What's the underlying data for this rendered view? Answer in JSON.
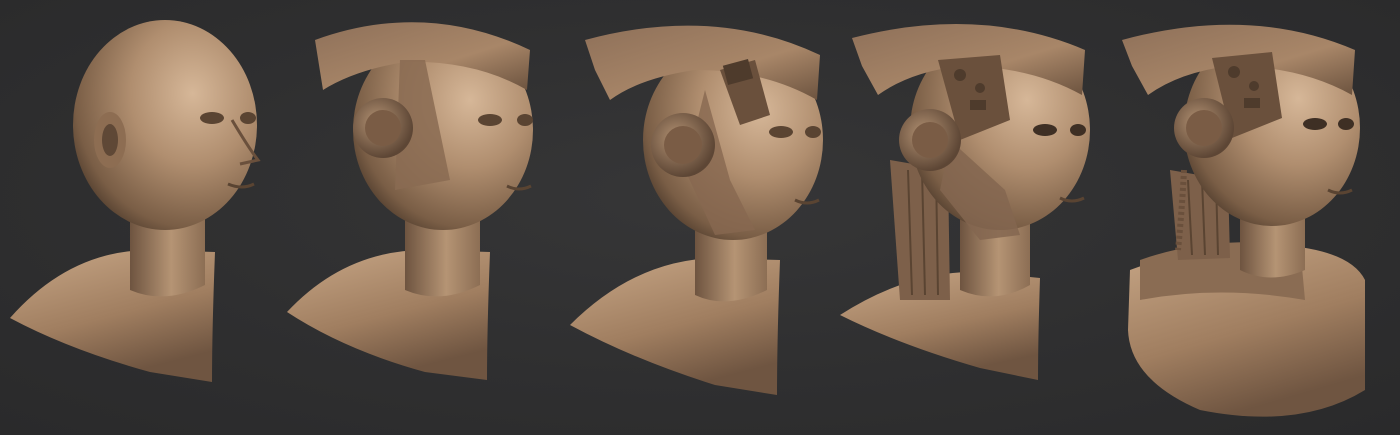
{
  "scene": {
    "background": "#2f2f30",
    "clay_light": "#c8a887",
    "clay_mid": "#9d7c5e",
    "clay_dark": "#5a4432",
    "stages": [
      {
        "id": 1,
        "state": "bare-head"
      },
      {
        "id": 2,
        "state": "helmet-blockout-with-headphone"
      },
      {
        "id": 3,
        "state": "helmet-with-cutout-panels"
      },
      {
        "id": 4,
        "state": "mechanical-details-and-neck-cables"
      },
      {
        "id": 5,
        "state": "full-bust-with-armored-shoulders"
      }
    ]
  }
}
